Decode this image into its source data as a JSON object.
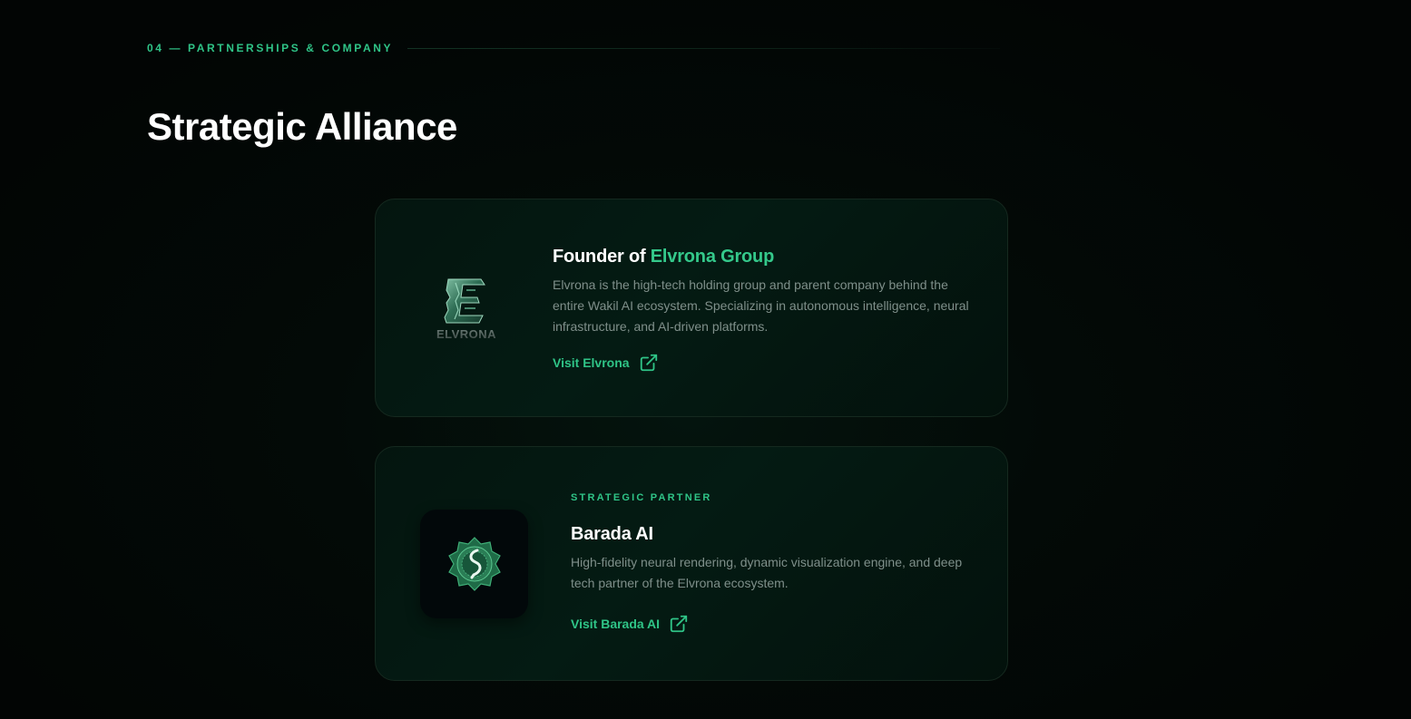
{
  "section": {
    "eyebrow": "04 — PARTNERSHIPS & COMPANY",
    "title": "Strategic Alliance"
  },
  "founder_card": {
    "title_prefix": "Founder of ",
    "title_accent": "Elvrona Group",
    "description": "Elvrona is the high-tech holding group and parent company behind the entire Wakil AI ecosystem. Specializing in autonomous intelligence, neural infrastructure, and AI-driven platforms.",
    "link_label": "Visit Elvrona",
    "link_icon": "external-link-icon",
    "logo_text": "ELVRONA"
  },
  "partner_card": {
    "eyebrow": "STRATEGIC PARTNER",
    "title": "Barada AI",
    "description": "High-fidelity neural rendering, dynamic visualization engine, and deep tech partner of the Elvrona ecosystem.",
    "link_label": "Visit Barada AI",
    "link_icon": "external-link-icon"
  },
  "colors": {
    "accent": "#2fc487",
    "background": "#020504",
    "card_border": "#15291f",
    "muted_text": "#7f8f8a"
  }
}
